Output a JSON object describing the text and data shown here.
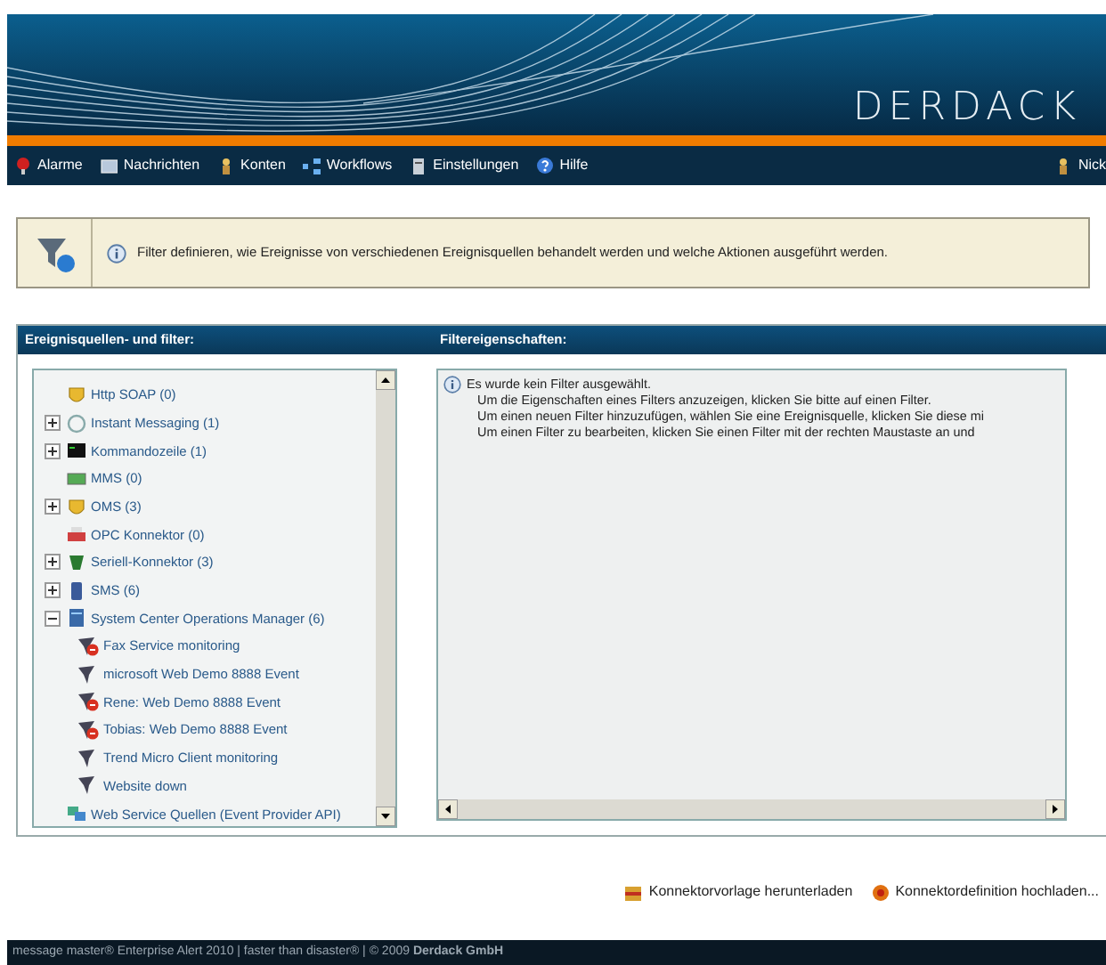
{
  "header": {
    "logo": "DERDACK"
  },
  "nav": [
    {
      "label": "Alarme",
      "kind": "alarm"
    },
    {
      "label": "Nachrichten",
      "kind": "messages"
    },
    {
      "label": "Konten",
      "kind": "accounts"
    },
    {
      "label": "Workflows",
      "kind": "workflow"
    },
    {
      "label": "Einstellungen",
      "kind": "settings"
    },
    {
      "label": "Hilfe",
      "kind": "help"
    },
    {
      "label": "Nick",
      "kind": "user"
    }
  ],
  "info_box": {
    "text": "Filter definieren, wie Ereignisse von verschiedenen Ereignisquellen behandelt werden und welche Aktionen ausgeführt werden."
  },
  "sources_panel": {
    "title": "Ereignisquellen- und filter:",
    "tree": [
      {
        "label": "Http SOAP (0)",
        "kind": "shield"
      },
      {
        "label": "Instant Messaging (1)",
        "kind": "chat",
        "expanded": false
      },
      {
        "label": "Kommandozeile (1)",
        "kind": "terminal",
        "expanded": false
      },
      {
        "label": "MMS (0)",
        "kind": "screen"
      },
      {
        "label": "OMS (3)",
        "kind": "shield",
        "expanded": false
      },
      {
        "label": "OPC Konnektor (0)",
        "kind": "plug"
      },
      {
        "label": "Seriell-Konnektor (3)",
        "kind": "serial",
        "expanded": false
      },
      {
        "label": "SMS (6)",
        "kind": "phone",
        "expanded": false
      },
      {
        "label": "System Center Operations Manager (6)",
        "kind": "server",
        "expanded": true,
        "children": [
          {
            "label": "Fax Service monitoring",
            "kind": "filter",
            "disabled": true
          },
          {
            "label": "microsoft Web Demo 8888 Event",
            "kind": "filter",
            "disabled": false
          },
          {
            "label": "Rene: Web Demo 8888 Event",
            "kind": "filter",
            "disabled": true
          },
          {
            "label": "Tobias: Web Demo 8888 Event",
            "kind": "filter",
            "disabled": true
          },
          {
            "label": "Trend Micro Client monitoring",
            "kind": "filter",
            "disabled": false
          },
          {
            "label": "Website down",
            "kind": "filter",
            "disabled": false
          }
        ]
      },
      {
        "label": "Web Service Quellen (Event Provider API)",
        "kind": "globe"
      }
    ]
  },
  "properties_panel": {
    "title": "Filtereigenschaften:",
    "lines": [
      "Es wurde kein Filter ausgewählt.",
      "Um die Eigenschaften eines Filters anzuzeigen, klicken Sie bitte auf einen Filter.",
      "Um einen neuen Filter hinzuzufügen, wählen Sie eine Ereignisquelle, klicken Sie diese mi",
      "Um einen Filter zu bearbeiten, klicken Sie einen Filter mit der rechten Maustaste an und"
    ]
  },
  "actions": [
    {
      "label": "Konnektorvorlage herunterladen",
      "kind": "download"
    },
    {
      "label": "Konnektordefinition hochladen...",
      "kind": "upload"
    }
  ],
  "footer": {
    "text": "message master® Enterprise Alert 2010 | faster than disaster® | © 2009 **Derdack GmbH**"
  }
}
